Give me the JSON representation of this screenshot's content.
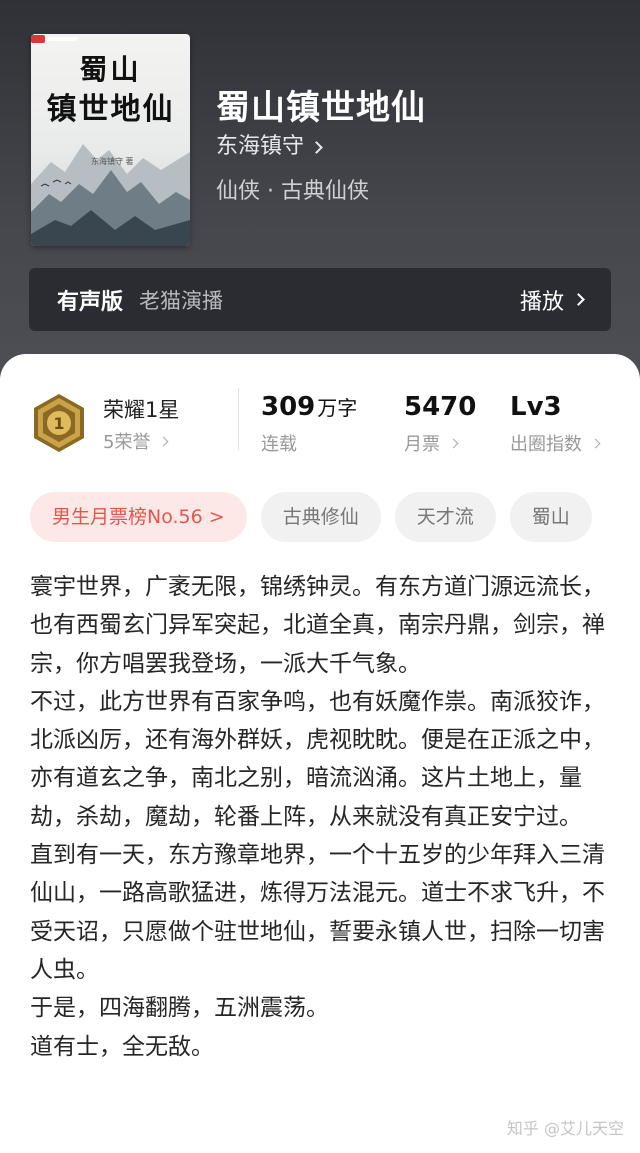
{
  "book": {
    "cover_title_line1": "蜀山",
    "cover_title_line2": "镇世地仙",
    "cover_author": "东海镇守 著",
    "title": "蜀山镇世地仙",
    "author": "东海镇守",
    "genre": "仙侠 · 古典仙侠"
  },
  "audio": {
    "label": "有声版",
    "narrator": "老猫演播",
    "play_label": "播放"
  },
  "stats": {
    "honor_title": "荣耀1星",
    "honor_sub": "5荣誉",
    "medal_level": "1",
    "words_value": "309",
    "words_unit": "万字",
    "words_label": "连载",
    "tickets_value": "5470",
    "tickets_label": "月票",
    "index_value": "Lv3",
    "index_label": "出圈指数"
  },
  "tags": [
    "男生月票榜No.56 >",
    "古典修仙",
    "天才流",
    "蜀山"
  ],
  "synopsis": [
    "寰宇世界，广袤无限，锦绣钟灵。有东方道门源远流长，也有西蜀玄门异军突起，北道全真，南宗丹鼎，剑宗，禅宗，你方唱罢我登场，一派大千气象。",
    "不过，此方世界有百家争鸣，也有妖魔作祟。南派狡诈，北派凶厉，还有海外群妖，虎视眈眈。便是在正派之中，亦有道玄之争，南北之别，暗流汹涌。这片土地上，量劫，杀劫，魔劫，轮番上阵，从来就没有真正安宁过。",
    "直到有一天，东方豫章地界，一个十五岁的少年拜入三清仙山，一路高歌猛进，炼得万法混元。道士不求飞升，不受天诏，只愿做个驻世地仙，誓要永镇人世，扫除一切害人虫。",
    "于是，四海翻腾，五洲震荡。",
    "道有士，全无敌。"
  ],
  "watermark": "知乎 @艾儿天空",
  "colors": {
    "rank_tag_text": "#e2564e",
    "rank_tag_bg": "#fde8e8",
    "hero_bg": "#3f4147"
  }
}
